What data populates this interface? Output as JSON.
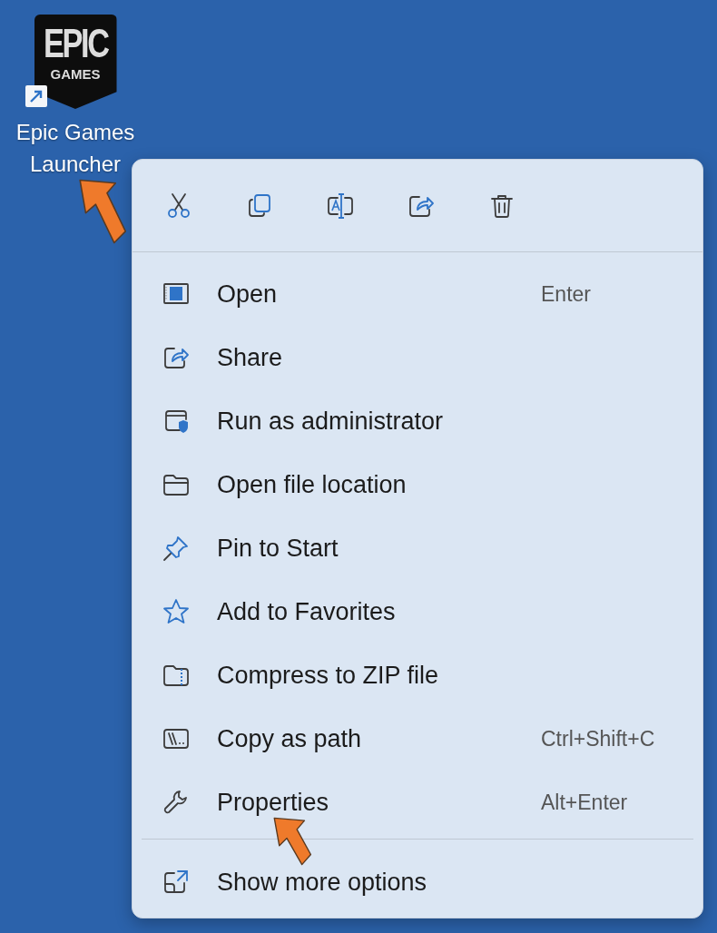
{
  "desktop_icon": {
    "logo_top": "EPIC",
    "logo_bottom": "GAMES",
    "label": "Epic Games Launcher"
  },
  "context_menu": {
    "items": [
      {
        "label": "Open",
        "shortcut": "Enter"
      },
      {
        "label": "Share"
      },
      {
        "label": "Run as administrator"
      },
      {
        "label": "Open file location"
      },
      {
        "label": "Pin to Start"
      },
      {
        "label": "Add to Favorites"
      },
      {
        "label": "Compress to ZIP file"
      },
      {
        "label": "Copy as path",
        "shortcut": "Ctrl+Shift+C"
      },
      {
        "label": "Properties",
        "shortcut": "Alt+Enter"
      }
    ],
    "footer_items": [
      {
        "label": "Show more options"
      }
    ]
  }
}
